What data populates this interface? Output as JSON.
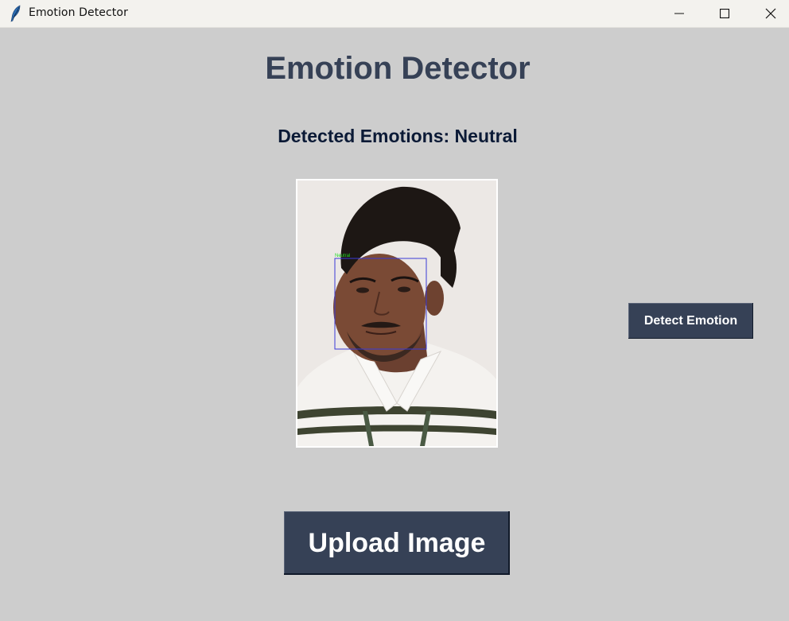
{
  "window": {
    "title": "Emotion Detector",
    "app_icon": "feather-icon",
    "controls": {
      "minimize_icon": "minimize-icon",
      "maximize_icon": "maximize-icon",
      "close_icon": "close-icon"
    }
  },
  "main": {
    "heading": "Emotion Detector",
    "result_text": "Detected Emotions: Neutral",
    "face_label": "Neutral",
    "detect_button_label": "Detect Emotion",
    "upload_button_label": "Upload Image"
  },
  "colors": {
    "background": "#cdcdcd",
    "heading": "#364156",
    "button_bg": "#364156",
    "button_text": "#ffffff",
    "face_box": "#3a3ad8",
    "face_label": "#22dd22"
  }
}
